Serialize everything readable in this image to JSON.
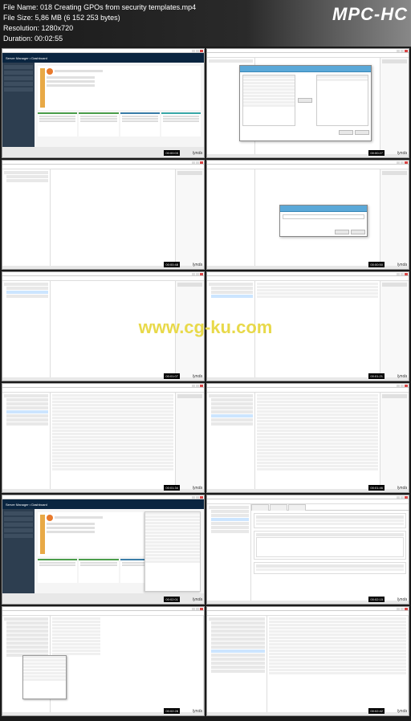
{
  "header": {
    "file_name_label": "File Name:",
    "file_name": "018 Creating GPOs from security templates.mp4",
    "file_size_label": "File Size:",
    "file_size": "5,86 MB (6 152 253 bytes)",
    "resolution_label": "Resolution:",
    "resolution": "1280x720",
    "duration_label": "Duration:",
    "duration": "00:02:55",
    "app_title": "MPC-HC"
  },
  "watermark": "www.cg-ku.com",
  "thumbnails": [
    {
      "timestamp": "00:00:03",
      "brand": "lynda"
    },
    {
      "timestamp": "00:00:27",
      "brand": "lynda"
    },
    {
      "timestamp": "00:00:48",
      "brand": "lynda"
    },
    {
      "timestamp": "00:00:50",
      "brand": "lynda"
    },
    {
      "timestamp": "00:01:07",
      "brand": "lynda"
    },
    {
      "timestamp": "00:01:21",
      "brand": "lynda"
    },
    {
      "timestamp": "00:01:34",
      "brand": "lynda"
    },
    {
      "timestamp": "00:01:46",
      "brand": "lynda"
    },
    {
      "timestamp": "00:02:01",
      "brand": "lynda"
    },
    {
      "timestamp": "00:02:15",
      "brand": "lynda"
    },
    {
      "timestamp": "00:02:28",
      "brand": "lynda"
    },
    {
      "timestamp": "00:02:42",
      "brand": "lynda"
    }
  ],
  "server_manager": {
    "title": "Server Manager • Dashboard"
  }
}
